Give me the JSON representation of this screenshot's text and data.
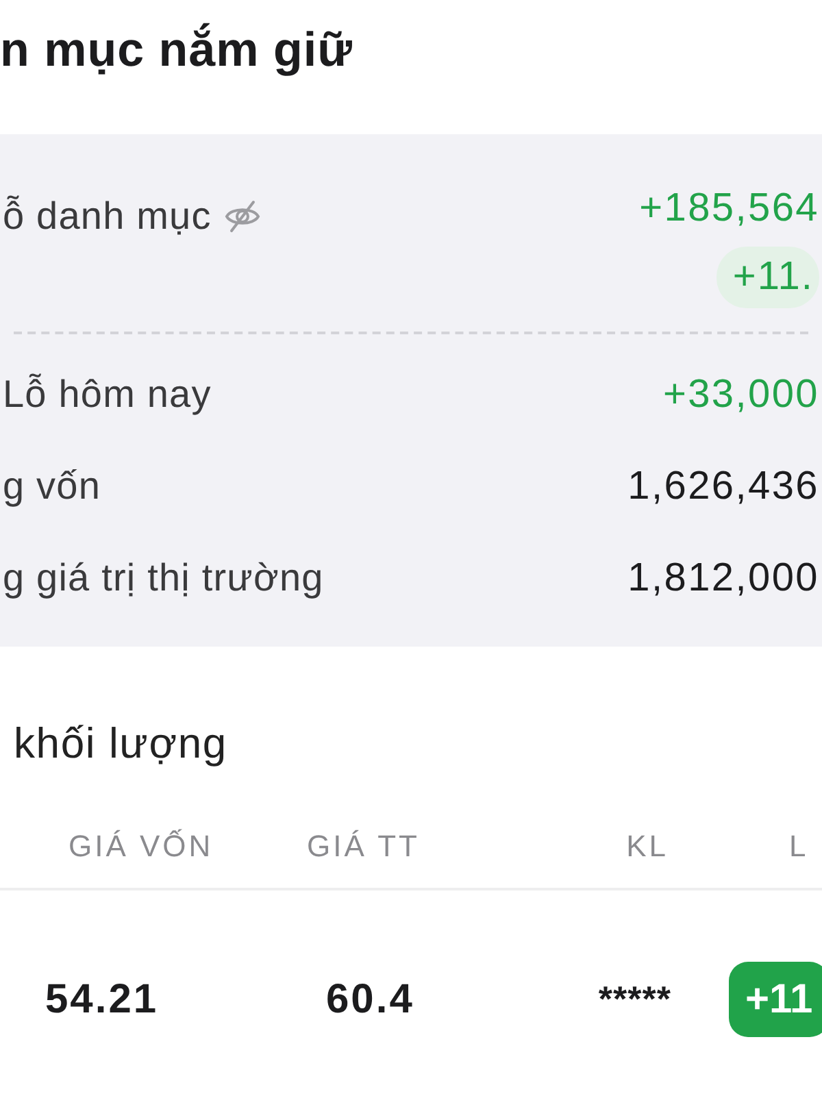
{
  "header": {
    "title": "n mục nắm giữ"
  },
  "summary": {
    "rows": [
      {
        "kind": "total",
        "label": "ỗ danh mục",
        "value": "+185,564",
        "color": "#22a34a",
        "percent": "+11."
      },
      {
        "kind": "plain",
        "label": "Lỗ hôm nay",
        "value": "+33,000",
        "color": "#22a34a"
      },
      {
        "kind": "plain",
        "label": "g vốn",
        "value": "1,626,436",
        "color": "#1c1c1e"
      },
      {
        "kind": "plain",
        "label": "g giá trị thị trường",
        "value": "1,812,000",
        "color": "#1c1c1e"
      }
    ]
  },
  "holdings": {
    "title": "khối lượng",
    "columns": [
      "GIÁ VỐN",
      "GIÁ TT",
      "KL",
      "L"
    ],
    "rows": [
      {
        "cells": [
          "54.21",
          "60.4",
          "*****"
        ],
        "change": "+11"
      }
    ]
  }
}
